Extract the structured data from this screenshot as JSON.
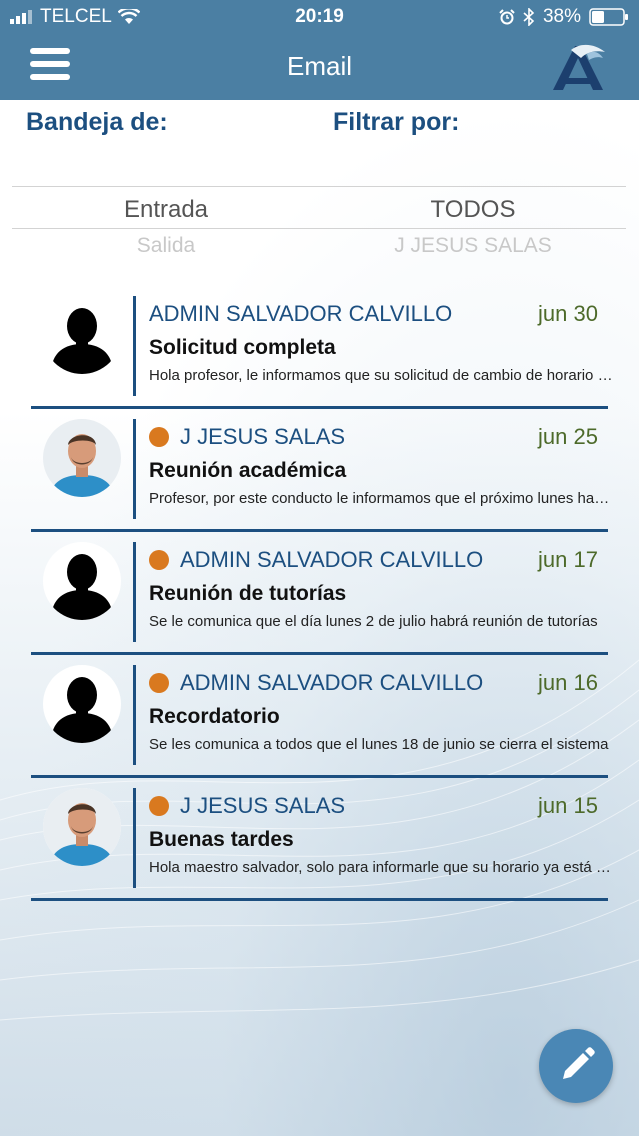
{
  "status_bar": {
    "carrier": "TELCEL",
    "time": "20:19",
    "battery": "38%"
  },
  "header": {
    "title": "Email"
  },
  "filters": {
    "mailbox_label": "Bandeja de:",
    "filter_label": "Filtrar por:",
    "mailbox_selected": "Entrada",
    "mailbox_next": "Salida",
    "filter_selected": "TODOS",
    "filter_next": "J JESUS SALAS"
  },
  "messages": [
    {
      "sender": "ADMIN SALVADOR CALVILLO",
      "date": "jun 30",
      "subject": "Solicitud completa",
      "preview": "Hola profesor, le informamos que su solicitud de cambio de horario ha sido aprobada",
      "unread": false,
      "avatar": "silhouette"
    },
    {
      "sender": "J JESUS SALAS",
      "date": "jun 25",
      "subject": "Reunión académica",
      "preview": "Profesor, por este conducto le informamos que el próximo lunes habrá reunión",
      "unread": true,
      "avatar": "photo"
    },
    {
      "sender": "ADMIN SALVADOR CALVILLO",
      "date": "jun 17",
      "subject": "Reunión de tutorías",
      "preview": "Se le comunica que el día lunes 2 de julio habrá reunión de tutorías",
      "unread": true,
      "avatar": "silhouette"
    },
    {
      "sender": "ADMIN SALVADOR CALVILLO",
      "date": "jun 16",
      "subject": "Recordatorio",
      "preview": "Se les comunica a todos que el lunes 18 de junio se cierra el sistema",
      "unread": true,
      "avatar": "silhouette"
    },
    {
      "sender": "J JESUS SALAS",
      "date": "jun 15",
      "subject": "Buenas tardes",
      "preview": "Hola maestro salvador, solo para informarle que su horario ya está disponible",
      "unread": true,
      "avatar": "photo"
    }
  ],
  "colors": {
    "header_bg": "#4b7fa3",
    "accent_blue": "#1c4f80",
    "unread_dot": "#d9791f",
    "date_green": "#4d6a2a",
    "fab_bg": "#4a87b5"
  },
  "icons": {
    "menu": "hamburger-icon",
    "logo": "app-logo",
    "compose": "pencil-icon"
  }
}
